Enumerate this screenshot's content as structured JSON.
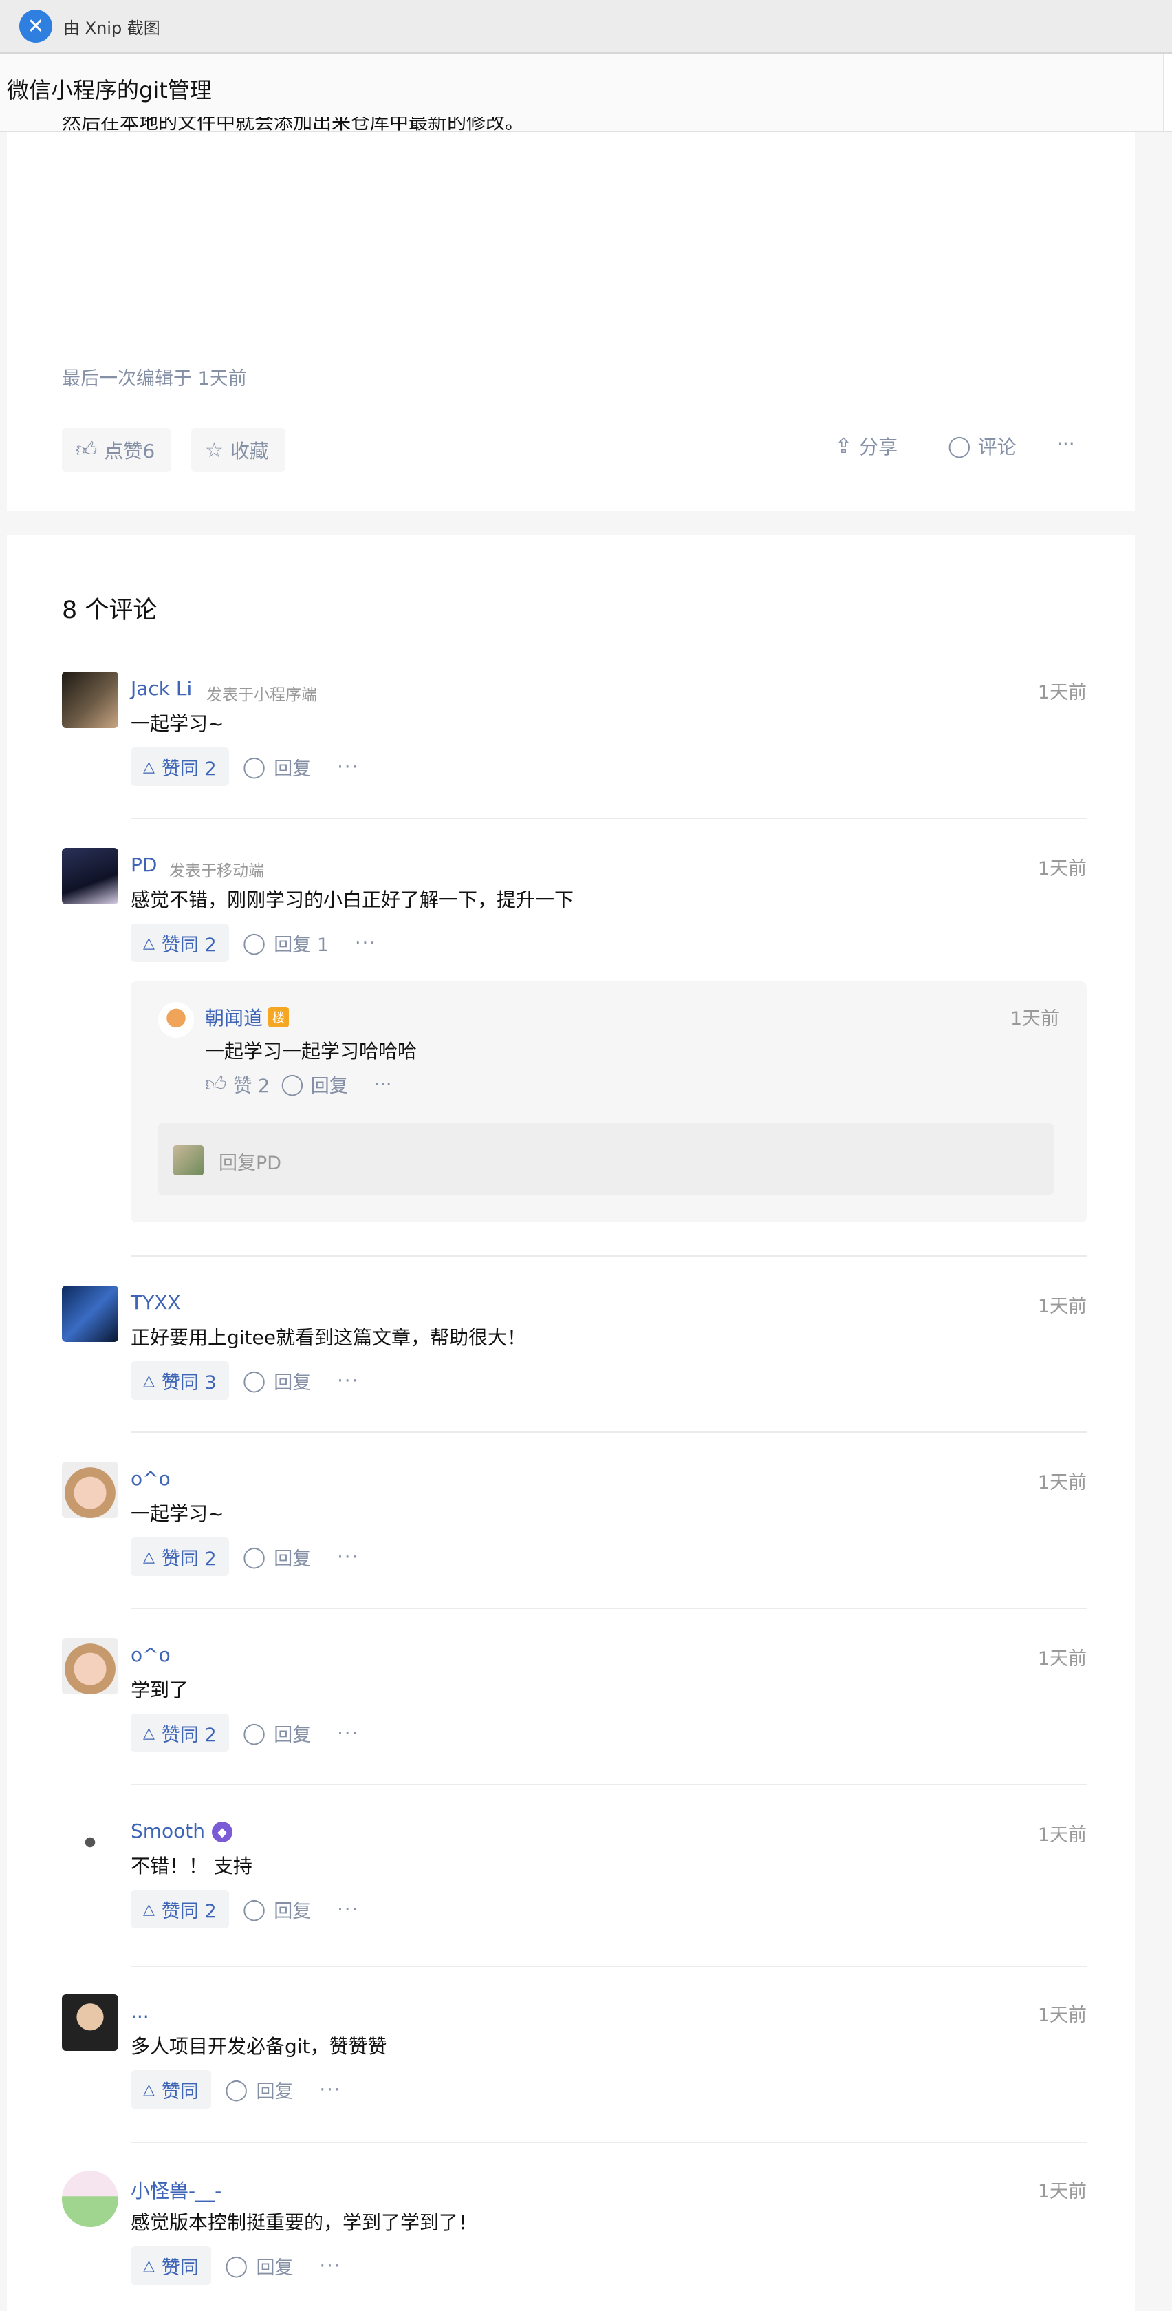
{
  "window": {
    "app_title": "由 Xnip 截图"
  },
  "page": {
    "title": "微信小程序的git管理"
  },
  "article": {
    "clipped_line": "然后在本地的文件中就会添加出来仓库中最新的修改。",
    "edited_label": "最后一次编辑于  1天前",
    "like_label": "点赞6",
    "collect_label": "收藏",
    "share_label": "分享",
    "comment_label": "评论",
    "more_label": "···"
  },
  "comments_section": {
    "heading": "8 个评论",
    "items": [
      {
        "author": "Jack Li",
        "source": "发表于小程序端",
        "time": "1天前",
        "text": "一起学习~",
        "vote": "赞同 2",
        "reply": "回复",
        "more": "···"
      },
      {
        "author": "PD",
        "source": "发表于移动端",
        "time": "1天前",
        "text": "感觉不错，刚刚学习的小白正好了解一下，提升一下",
        "vote": "赞同 2",
        "reply": "回复 1",
        "more": "···"
      },
      {
        "author": "TYXX",
        "source": "",
        "time": "1天前",
        "text": "正好要用上gitee就看到这篇文章，帮助很大！",
        "vote": "赞同 3",
        "reply": "回复",
        "more": "···"
      },
      {
        "author": "o^o",
        "source": "",
        "time": "1天前",
        "text": "一起学习~",
        "vote": "赞同 2",
        "reply": "回复",
        "more": "···"
      },
      {
        "author": "o^o",
        "source": "",
        "time": "1天前",
        "text": "学到了",
        "vote": "赞同 2",
        "reply": "回复",
        "more": "···"
      },
      {
        "author": "Smooth",
        "source": "",
        "time": "1天前",
        "text": "不错！！ 支持",
        "vote": "赞同 2",
        "reply": "回复",
        "more": "···"
      },
      {
        "author": "...",
        "source": "",
        "time": "1天前",
        "text": "多人项目开发必备git，赞赞赞",
        "vote": "赞同",
        "reply": "回复",
        "more": "···"
      },
      {
        "author": "小怪兽-__-",
        "source": "",
        "time": "1天前",
        "text": "感觉版本控制挺重要的，学到了学到了！",
        "vote": "赞同",
        "reply": "回复",
        "more": "···"
      }
    ],
    "sub_reply": {
      "author": "朝闻道",
      "badge": "楼",
      "time": "1天前",
      "text": "一起学习一起学习哈哈哈",
      "like": "赞 2",
      "reply": "回复",
      "more": "···",
      "reply_placeholder": "回复PD"
    }
  },
  "colors": {
    "accent": "#3d64b6",
    "muted": "#8590a6",
    "badge_orange": "#f5a623",
    "badge_purple": "#7b5cd6"
  },
  "icons": [
    "xnip-logo-icon",
    "thumb-up-icon",
    "star-icon",
    "share-icon",
    "comment-icon",
    "more-icon",
    "triangle-up-icon"
  ]
}
